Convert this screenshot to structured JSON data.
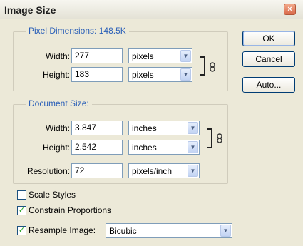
{
  "window": {
    "title": "Image Size",
    "close_glyph": "×"
  },
  "pixel_dimensions": {
    "legend": "Pixel Dimensions:",
    "size": "148.5K",
    "width": {
      "label": "Width:",
      "value": "277",
      "unit": "pixels"
    },
    "height": {
      "label": "Height:",
      "value": "183",
      "unit": "pixels"
    }
  },
  "document_size": {
    "legend": "Document Size:",
    "width": {
      "label": "Width:",
      "value": "3.847",
      "unit": "inches"
    },
    "height": {
      "label": "Height:",
      "value": "2.542",
      "unit": "inches"
    },
    "resolution": {
      "label": "Resolution:",
      "value": "72",
      "unit": "pixels/inch"
    }
  },
  "options": {
    "scale_styles": {
      "label": "Scale Styles",
      "checked": false
    },
    "constrain_proportions": {
      "label": "Constrain Proportions",
      "checked": true
    },
    "resample_image": {
      "label": "Resample Image:",
      "checked": true,
      "method": "Bicubic"
    }
  },
  "buttons": {
    "ok": "OK",
    "cancel": "Cancel",
    "auto": "Auto..."
  },
  "icons": {
    "dropdown_arrow": "▼",
    "check_mark": "✓",
    "link": "chain-link-icon"
  },
  "colors": {
    "legend_text": "#2a5fb8",
    "check_mark": "#21a121",
    "dialog_bg": "#ece9d8"
  }
}
